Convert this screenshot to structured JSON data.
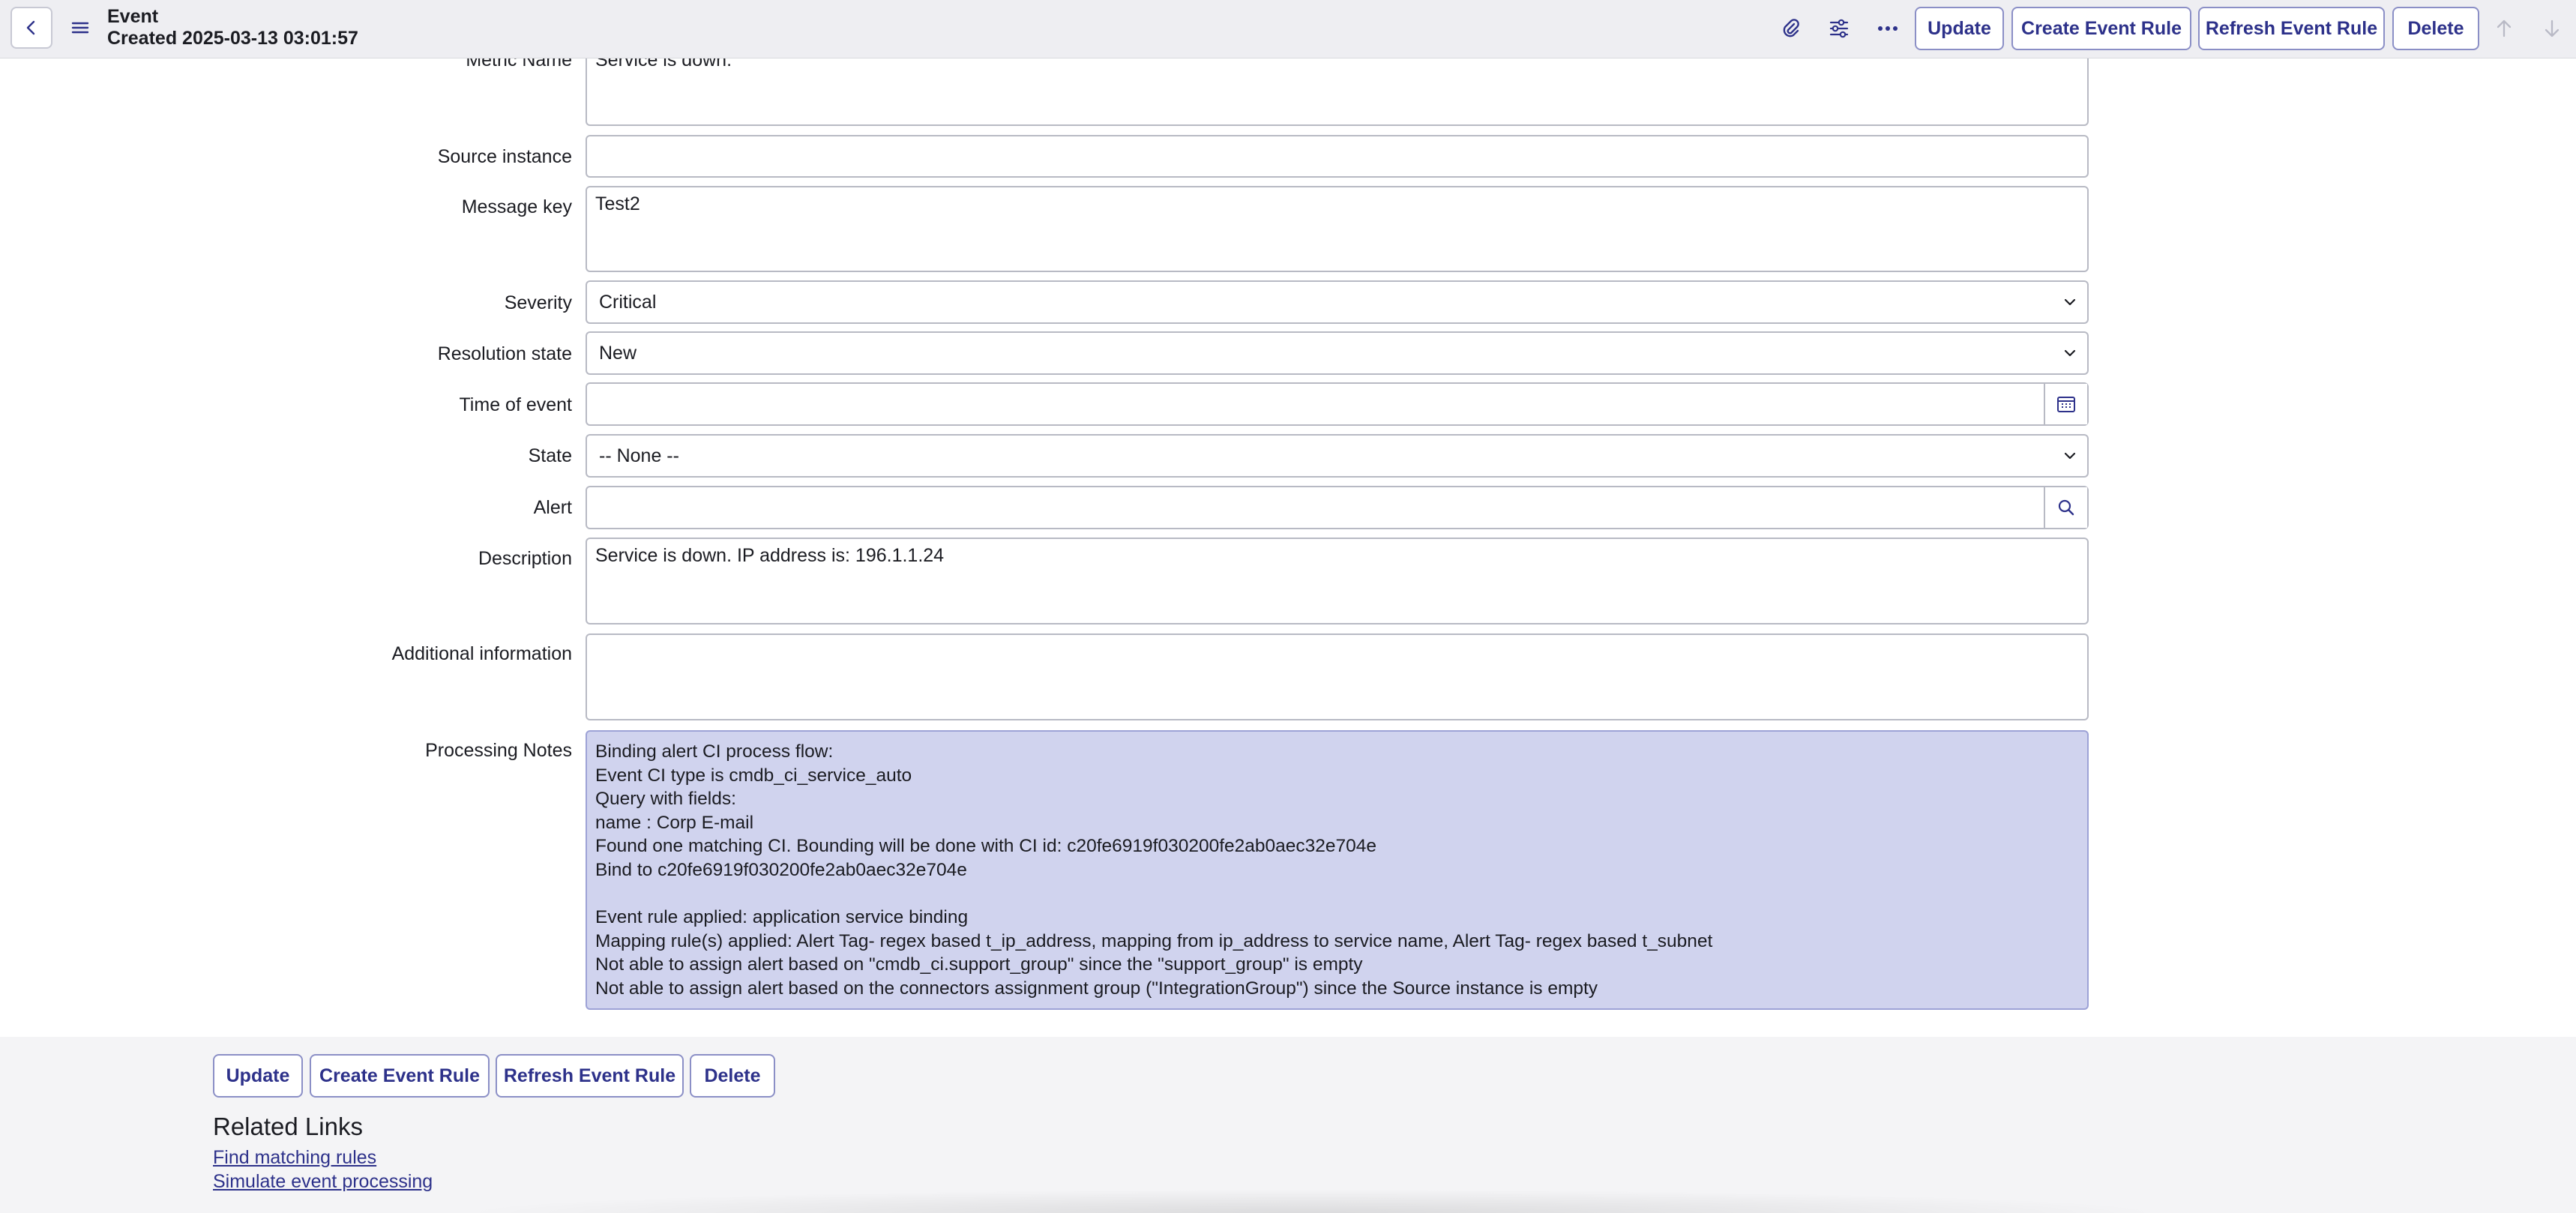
{
  "header": {
    "title": "Event",
    "subtitle": "Created 2025-03-13 03:01:57",
    "buttons": {
      "update": "Update",
      "create_rule": "Create Event Rule",
      "refresh_rule": "Refresh Event Rule",
      "delete": "Delete"
    },
    "icons": [
      "chevron-left-icon",
      "hamburger-icon",
      "paperclip-icon",
      "sliders-icon",
      "more-icon",
      "arrow-up-icon",
      "arrow-down-icon"
    ]
  },
  "form": {
    "metric_name": {
      "label": "Metric Name",
      "value": "Service is down."
    },
    "source_instance": {
      "label": "Source instance",
      "value": ""
    },
    "message_key": {
      "label": "Message key",
      "value": "Test2"
    },
    "severity": {
      "label": "Severity",
      "value": "Critical"
    },
    "resolution_state": {
      "label": "Resolution state",
      "value": "New"
    },
    "time_of_event": {
      "label": "Time of event",
      "value": ""
    },
    "state": {
      "label": "State",
      "value": "-- None --"
    },
    "alert": {
      "label": "Alert",
      "value": ""
    },
    "description": {
      "label": "Description",
      "value": "Service is down. IP address is: 196.1.1.24"
    },
    "additional_information": {
      "label": "Additional information",
      "value": ""
    },
    "processing_notes": {
      "label": "Processing Notes",
      "lines": [
        "Binding alert CI process flow:",
        "Event CI type is cmdb_ci_service_auto",
        "Query with fields:",
        "name : Corp E-mail",
        "Found one matching CI. Bounding will be done with CI id: c20fe6919f030200fe2ab0aec32e704e",
        "Bind to c20fe6919f030200fe2ab0aec32e704e",
        "",
        "Event rule applied: application service binding",
        "Mapping rule(s) applied: Alert Tag- regex based t_ip_address, mapping from ip_address to service name, Alert Tag- regex based t_subnet",
        "Not able to assign alert based on \"cmdb_ci.support_group\" since the \"support_group\" is empty",
        "Not able to assign alert based on the connectors assignment group (\"IntegrationGroup\") since the Source instance is empty"
      ]
    }
  },
  "footer": {
    "buttons": {
      "update": "Update",
      "create_rule": "Create Event Rule",
      "refresh_rule": "Refresh Event Rule",
      "delete": "Delete"
    },
    "related_title": "Related Links",
    "links": [
      "Find matching rules",
      "Simulate event processing"
    ]
  },
  "colors": {
    "accent": "#2d318a",
    "notes_bg": "#d0d3ee",
    "header_bg": "#eeeef2"
  }
}
